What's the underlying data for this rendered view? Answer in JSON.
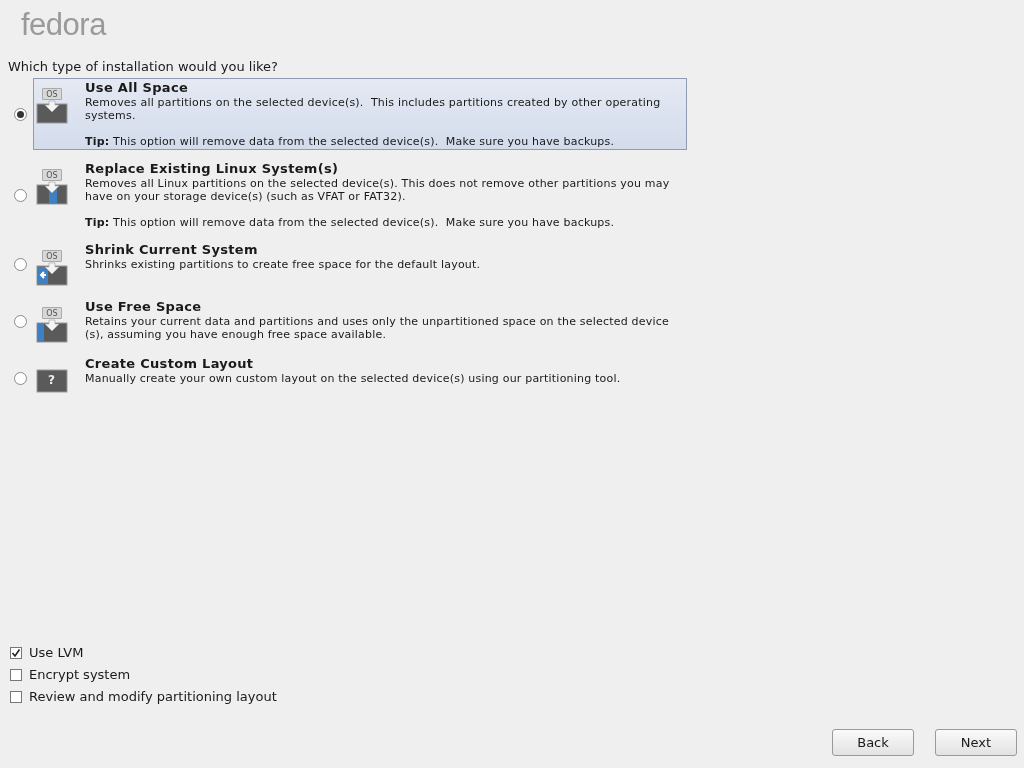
{
  "logo": "fedora",
  "question": "Which type of installation would you like?",
  "options": [
    {
      "kind": "all",
      "badge": "OS",
      "selected": true,
      "title": "Use All Space",
      "lines": [
        "Removes all partitions on the selected device(s).  This includes partitions created by other operating",
        "systems."
      ],
      "tip": "**Tip:** This option will remove data from the selected device(s).  Make sure you have backups."
    },
    {
      "kind": "replace",
      "badge": "OS",
      "selected": false,
      "title": "Replace Existing Linux System(s)",
      "lines": [
        "Removes all Linux partitions on the selected device(s). This does not remove other partitions you may",
        "have on your storage device(s) (such as VFAT or FAT32)."
      ],
      "tip": "**Tip:** This option will remove data from the selected device(s).  Make sure you have backups."
    },
    {
      "kind": "shrink",
      "badge": "OS",
      "selected": false,
      "title": "Shrink Current System",
      "lines": [
        "Shrinks existing partitions to create free space for the default layout."
      ]
    },
    {
      "kind": "free",
      "badge": "OS",
      "selected": false,
      "title": "Use Free Space",
      "lines": [
        "Retains your current data and partitions and uses only the unpartitioned space on the selected device",
        "(s), assuming you have enough free space available."
      ]
    },
    {
      "kind": "custom",
      "badge": "?",
      "selected": false,
      "title": "Create Custom Layout",
      "lines": [
        "Manually create your own custom layout on the selected device(s) using our partitioning tool."
      ]
    }
  ],
  "checkboxes": [
    {
      "label": "Use LVM",
      "checked": true
    },
    {
      "label": "Encrypt system",
      "checked": false
    },
    {
      "label": "Review and modify partitioning layout",
      "checked": false
    }
  ],
  "buttons": [
    "Back",
    "Next"
  ]
}
